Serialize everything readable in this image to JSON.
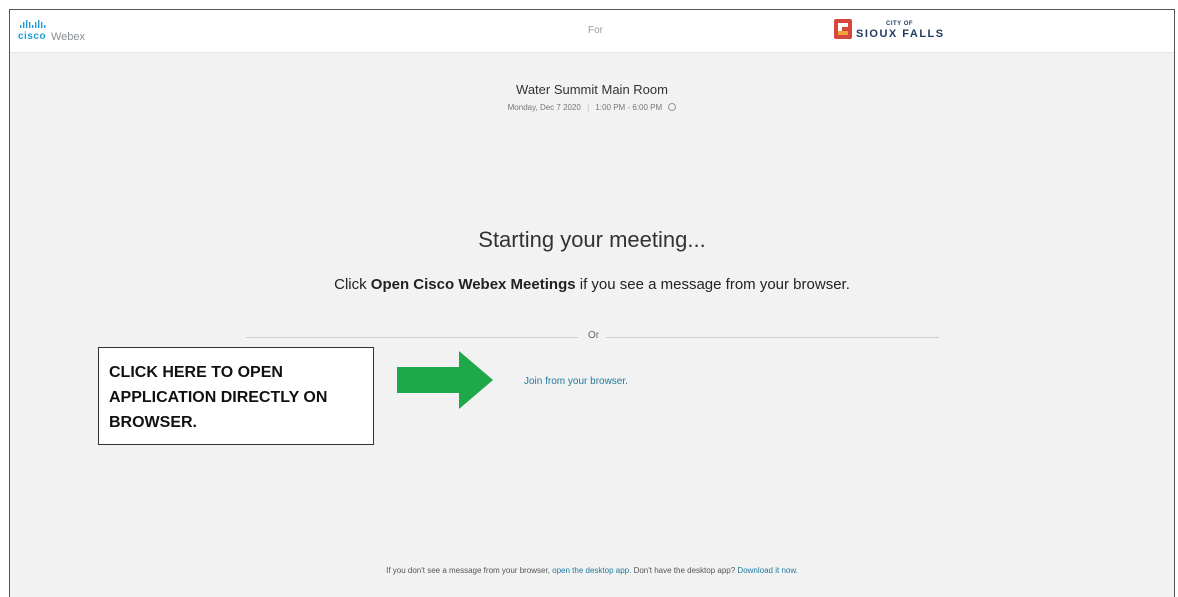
{
  "header": {
    "cisco_wordmark": "cisco",
    "app_name": "Webex",
    "for_label": "For",
    "partner_logo": {
      "small_text": "CITY OF",
      "big_text": "SIOUX FALLS"
    }
  },
  "meeting": {
    "title": "Water Summit Main Room",
    "date": "Monday, Dec 7 2020",
    "separator": "|",
    "time": "1:00 PM - 6:00 PM"
  },
  "main": {
    "status_heading": "Starting your meeting...",
    "instruction": {
      "prefix": "Click",
      "app_name": "Open Cisco Webex Meetings",
      "suffix": "if you see a message from your browser."
    },
    "or_label": "Or",
    "join_link": "Join from your browser."
  },
  "annotation": {
    "callout_text": "CLICK HERE TO OPEN APPLICATION DIRECTLY ON BROWSER.",
    "arrow_color": "#1fa84a"
  },
  "footer": {
    "text_before": "If you don't see a message from your browser,",
    "open_desktop_link": "open the desktop app.",
    "text_middle": "Don't have the desktop app?",
    "download_link": "Download it now."
  },
  "colors": {
    "cisco_blue": "#1e9bd7",
    "link": "#1f7a9e",
    "logo_red": "#d8473d",
    "logo_orange": "#f2a33a",
    "logo_navy": "#1f3a5f"
  },
  "icons": [
    "cisco-logo-icon",
    "info-icon",
    "city-logo-icon",
    "arrow-right-icon"
  ]
}
